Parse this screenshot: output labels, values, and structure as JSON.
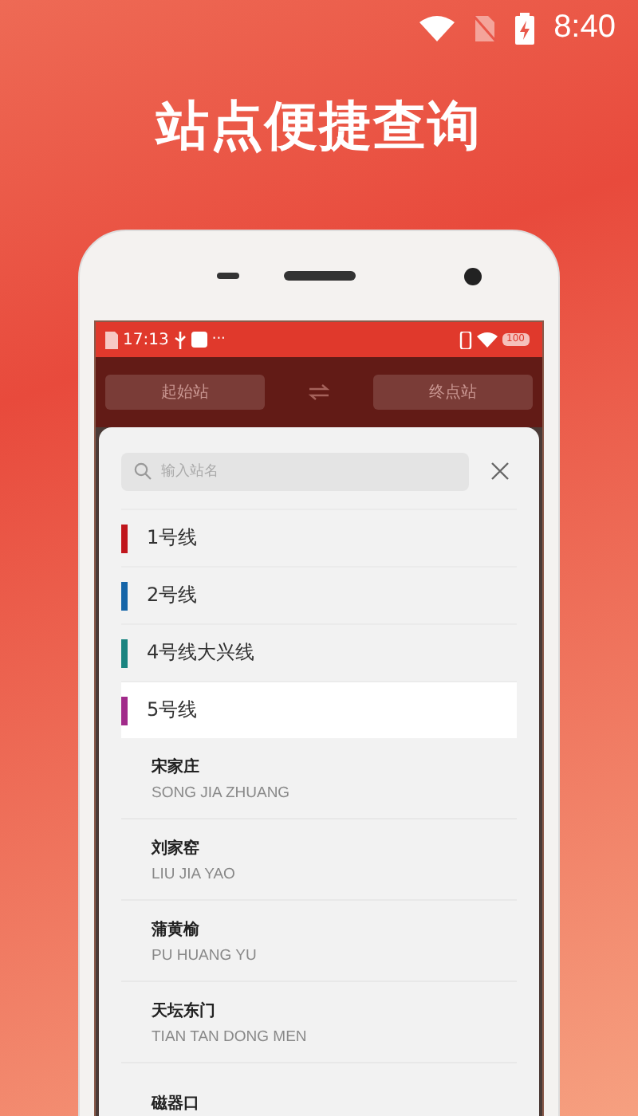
{
  "status_bar": {
    "time": "8:40"
  },
  "headline": "站点便捷查询",
  "phone": {
    "status_bar": {
      "time": "17:13",
      "more": "···",
      "battery": "100"
    },
    "route": {
      "from": "起始站",
      "to": "终点站"
    },
    "search": {
      "placeholder": "输入站名"
    },
    "lines": [
      {
        "name": "1号线",
        "color": "#c0161c",
        "selected": false
      },
      {
        "name": "2号线",
        "color": "#1565a8",
        "selected": false
      },
      {
        "name": "4号线大兴线",
        "color": "#1a8480",
        "selected": false
      },
      {
        "name": "5号线",
        "color": "#a12a8a",
        "selected": true
      }
    ],
    "stations": [
      {
        "name": "宋家庄",
        "pinyin": "SONG JIA ZHUANG"
      },
      {
        "name": "刘家窑",
        "pinyin": "LIU JIA YAO"
      },
      {
        "name": "蒲黄榆",
        "pinyin": "PU HUANG YU"
      },
      {
        "name": "天坛东门",
        "pinyin": "TIAN TAN DONG MEN"
      },
      {
        "name": "磁器口"
      }
    ]
  }
}
